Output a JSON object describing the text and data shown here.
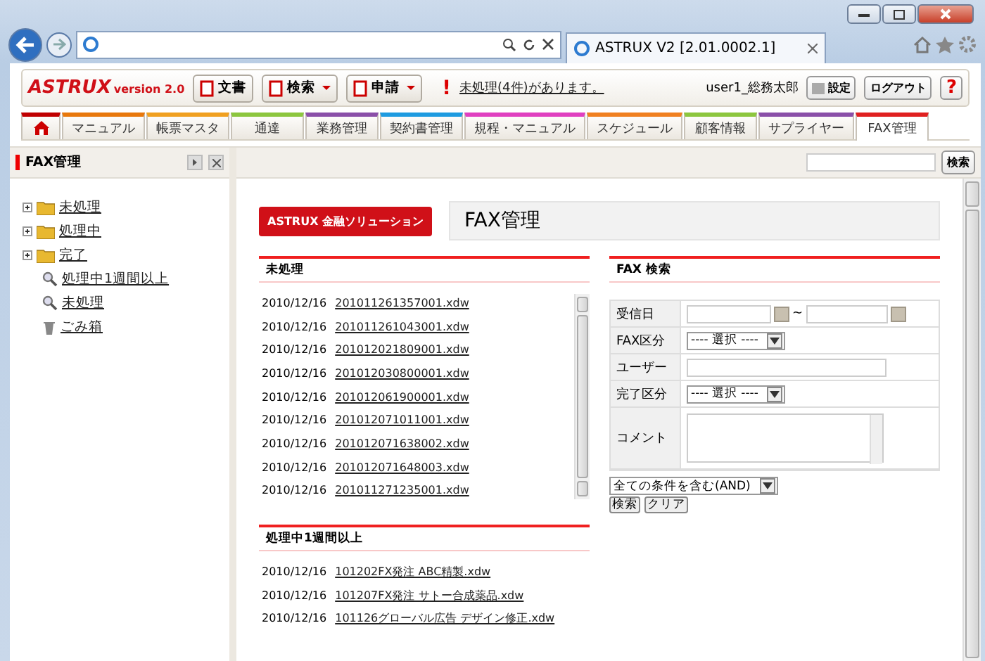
{
  "browser": {
    "tab_title": "ASTRUX V2 [2.01.0002.1]"
  },
  "header": {
    "logo": "ASTRUX",
    "version": "version 2.0",
    "tools": [
      {
        "label": "文書",
        "dropdown": false
      },
      {
        "label": "検索",
        "dropdown": true
      },
      {
        "label": "申請",
        "dropdown": true
      }
    ],
    "alert_mark": "!",
    "alert": "未処理(4件)があります。",
    "user": "user1_総務太郎",
    "settings": "設定",
    "logout": "ログアウト",
    "help": "?"
  },
  "tabs": [
    {
      "kind": "home",
      "color": "#c00000",
      "selected": false
    },
    {
      "kind": "text",
      "label": "マニュアル",
      "color": "#e8780c",
      "selected": false
    },
    {
      "kind": "text",
      "label": "帳票マスタ",
      "color": "#f0a020",
      "selected": false
    },
    {
      "kind": "text",
      "label": "通達",
      "color": "#8cc63e",
      "selected": false
    },
    {
      "kind": "text",
      "label": "業務管理",
      "color": "#8a4fa8",
      "selected": false
    },
    {
      "kind": "text",
      "label": "契約書管理",
      "color": "#1e9be0",
      "selected": false
    },
    {
      "kind": "text",
      "label": "規程・マニュアル",
      "color": "#e040c0",
      "selected": false
    },
    {
      "kind": "text",
      "label": "スケジュール",
      "color": "#f08020",
      "selected": false
    },
    {
      "kind": "text",
      "label": "顧客情報",
      "color": "#8cc63e",
      "selected": false
    },
    {
      "kind": "text",
      "label": "サプライヤー",
      "color": "#8a4fa8",
      "selected": false
    },
    {
      "kind": "text",
      "label": "FAX管理",
      "color": "#e02020",
      "selected": true
    }
  ],
  "sidebar": {
    "title": "FAX管理",
    "items": [
      {
        "kind": "folder",
        "label": "未処理",
        "expanded": false
      },
      {
        "kind": "folder",
        "label": "処理中",
        "expanded": false
      },
      {
        "kind": "folder",
        "label": "完了",
        "expanded": false
      },
      {
        "kind": "search",
        "label": "処理中1週間以上"
      },
      {
        "kind": "search",
        "label": "未処理"
      },
      {
        "kind": "trash",
        "label": "ごみ箱"
      }
    ]
  },
  "toolbar": {
    "search_button": "検索"
  },
  "page": {
    "badge": "ASTRUX 金融ソリューション",
    "title": "FAX管理",
    "lists": [
      {
        "title": "未処理",
        "scrollable": true,
        "rows": [
          {
            "date": "2010/12/16",
            "file": "201011261357001.xdw"
          },
          {
            "date": "2010/12/16",
            "file": "201011261043001.xdw"
          },
          {
            "date": "2010/12/16",
            "file": "201012021809001.xdw"
          },
          {
            "date": "2010/12/16",
            "file": "201012030800001.xdw"
          },
          {
            "date": "2010/12/16",
            "file": "201012061900001.xdw"
          },
          {
            "date": "2010/12/16",
            "file": "201012071011001.xdw"
          },
          {
            "date": "2010/12/16",
            "file": "201012071638002.xdw"
          },
          {
            "date": "2010/12/16",
            "file": "201012071648003.xdw"
          },
          {
            "date": "2010/12/16",
            "file": "201011271235001.xdw"
          }
        ]
      },
      {
        "title": "処理中1週間以上",
        "scrollable": false,
        "rows": [
          {
            "date": "2010/12/16",
            "file": "101202FX発注 ABC精製.xdw"
          },
          {
            "date": "2010/12/16",
            "file": "101207FX発注 サトー合成薬品.xdw"
          },
          {
            "date": "2010/12/16",
            "file": "101126グローバル広告 デザイン修正.xdw"
          }
        ]
      }
    ],
    "search": {
      "title": "FAX 検索",
      "fields": [
        {
          "kind": "daterange",
          "label": "受信日",
          "separator": "~"
        },
        {
          "kind": "select",
          "label": "FAX区分",
          "value": "---- 選択 ----"
        },
        {
          "kind": "text",
          "label": "ユーザー"
        },
        {
          "kind": "select",
          "label": "完了区分",
          "value": "---- 選択 ----"
        },
        {
          "kind": "textarea",
          "label": "コメント"
        }
      ],
      "match": "全ての条件を含む(AND)",
      "buttons": [
        "検索",
        "クリア"
      ]
    }
  }
}
